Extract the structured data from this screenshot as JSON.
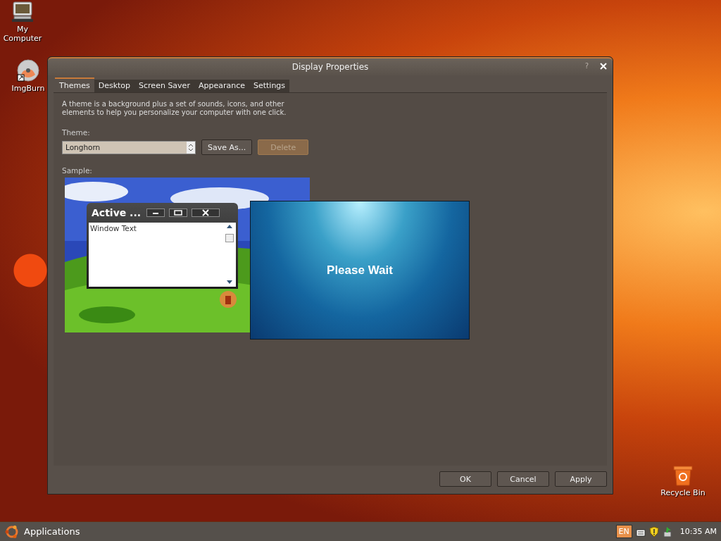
{
  "desktop_icons": [
    {
      "label": "My Computer",
      "kind": "computer"
    },
    {
      "label": "ImgBurn",
      "kind": "disc"
    },
    {
      "label": "Recycle Bin",
      "kind": "bin"
    }
  ],
  "dialog": {
    "title": "Display Properties",
    "help": "?",
    "tabs": [
      {
        "label": "Themes",
        "selected": true
      },
      {
        "label": "Desktop",
        "selected": false
      },
      {
        "label": "Screen Saver",
        "selected": false
      },
      {
        "label": "Appearance",
        "selected": false
      },
      {
        "label": "Settings",
        "selected": false
      }
    ],
    "description": "A theme is a background plus a set of sounds, icons, and other elements to help you personalize your computer with one click.",
    "theme_label": "Theme:",
    "theme_value": "Longhorn",
    "theme_buttons": [
      {
        "label": "Save As...",
        "disabled": false
      },
      {
        "label": "Delete",
        "disabled": true
      }
    ],
    "sample_label": "Sample:",
    "sample_window": {
      "title": "Active ...",
      "text": "Window Text"
    },
    "buttons": [
      {
        "label": "OK"
      },
      {
        "label": "Cancel"
      },
      {
        "label": "Apply"
      }
    ]
  },
  "overlay": {
    "message": "Please Wait"
  },
  "taskbar": {
    "menu": "Applications",
    "language": "EN",
    "clock": "10:35 AM"
  }
}
